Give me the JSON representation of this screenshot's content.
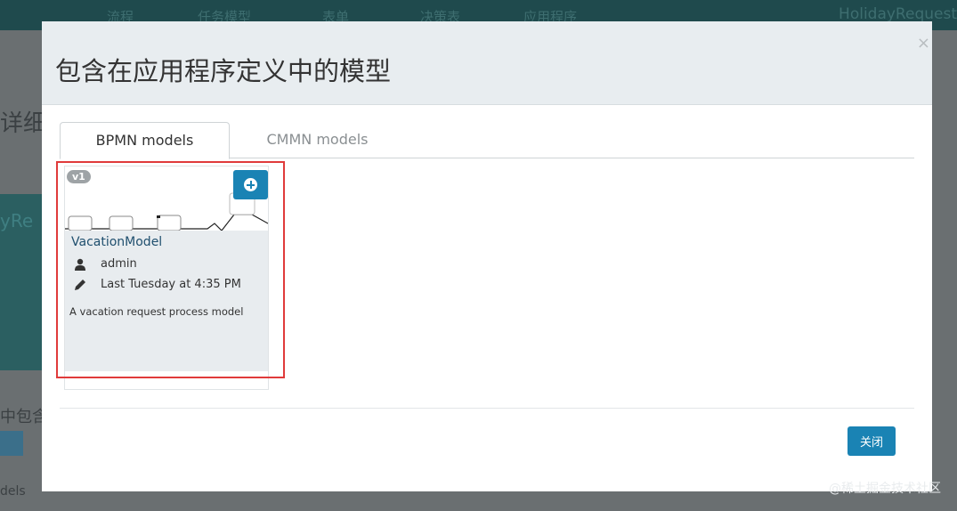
{
  "background": {
    "nav_items": [
      "流程",
      "任务模型",
      "表单",
      "决策表",
      "应用程序"
    ],
    "brand": "HolidayRequest",
    "side_fragments": [
      "详细",
      "yRe",
      "中包含",
      "dels"
    ]
  },
  "modal": {
    "title": "包含在应用程序定义中的模型",
    "close_glyph": "×",
    "tabs": [
      {
        "label": "BPMN models",
        "active": true
      },
      {
        "label": "CMMN models",
        "active": false
      }
    ],
    "card": {
      "version": "v1",
      "model_name": "VacationModel",
      "author": "admin",
      "modified": "Last Tuesday at 4:35 PM",
      "description": "A vacation request process model"
    },
    "footer_button": "关闭"
  },
  "watermark": "@稀土掘金技术社区",
  "colors": {
    "primary": "#1a83b4",
    "highlight": "#e03b3b",
    "header_bg": "#e8edf0",
    "card_bg": "#e8ecef"
  },
  "icons": {
    "add": "plus-circle-icon",
    "author": "user-icon",
    "modified": "pencil-icon",
    "close": "close-icon"
  }
}
